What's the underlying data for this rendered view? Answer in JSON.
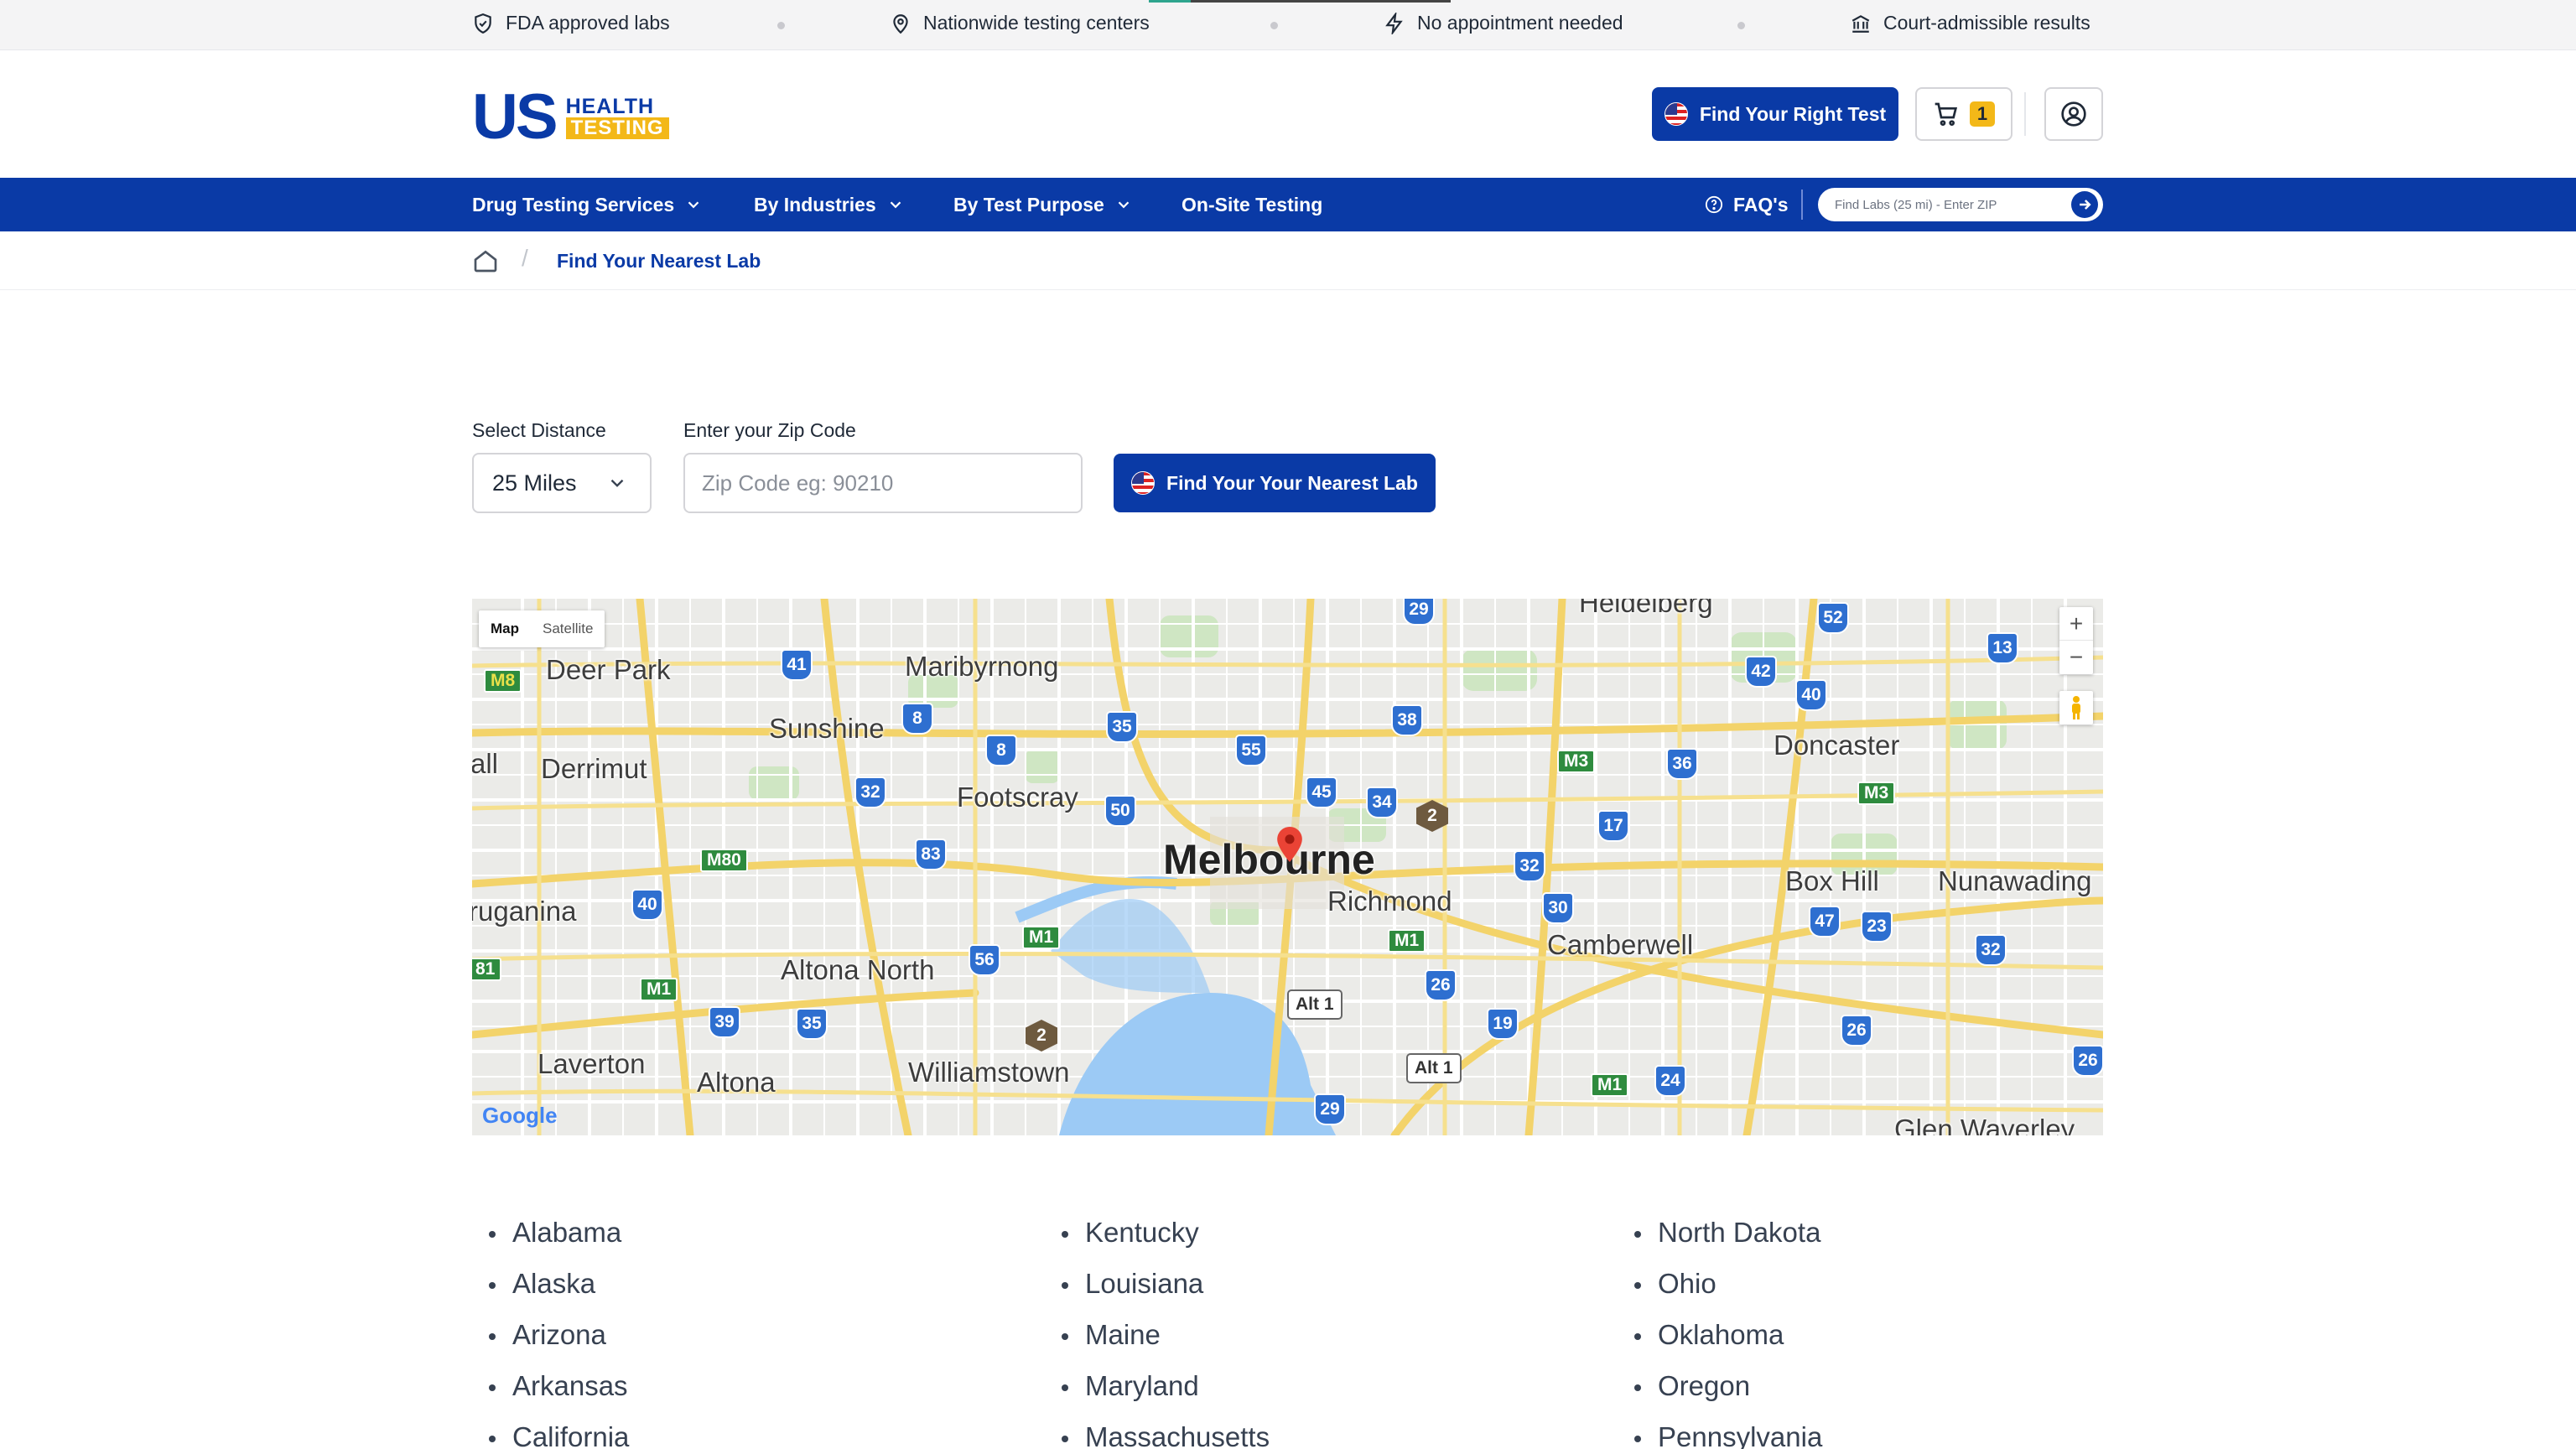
{
  "trust_bar": {
    "items": [
      {
        "label": "FDA approved labs",
        "icon": "shield-check-icon"
      },
      {
        "label": "Nationwide testing centers",
        "icon": "map-pin-icon"
      },
      {
        "label": "No appointment needed",
        "icon": "lightning-icon"
      },
      {
        "label": "Court-admissible results",
        "icon": "courthouse-icon"
      }
    ]
  },
  "brand": {
    "us": "US",
    "health": "HEALTH",
    "testing": "TESTING",
    "primary_color": "#0a3aa6",
    "accent_color": "#f3b818"
  },
  "header": {
    "find_test_label": "Find Your Right Test",
    "cart_count": "1"
  },
  "nav": {
    "items": [
      "Drug Testing Services",
      "By Industries",
      "By Test Purpose",
      "On-Site Testing"
    ],
    "faq_label": "FAQ's",
    "search_placeholder": "Find Labs (25 mi) - Enter ZIP"
  },
  "breadcrumb": {
    "current": "Find Your Nearest Lab"
  },
  "form": {
    "distance_label": "Select Distance",
    "distance_value": "25 Miles",
    "zip_label": "Enter your Zip Code",
    "zip_placeholder": "Zip Code eg: 90210",
    "submit_label": "Find Your Your Nearest Lab"
  },
  "map": {
    "toggle_map": "Map",
    "toggle_satellite": "Satellite",
    "zoom_in": "+",
    "zoom_out": "−",
    "attribution": "Google",
    "center_city": "Melbourne",
    "suburbs": [
      "Heidelberg",
      "Deer Park",
      "Maribyrnong",
      "Sunshine",
      "Derrimut",
      "Footscray",
      "Doncaster",
      "Richmond",
      "Box Hill",
      "Nunawading",
      "Camberwell",
      "Altona North",
      "Laverton",
      "Altona",
      "Williamstown",
      "Glen Waverley",
      "ruganina",
      "all"
    ],
    "routes": [
      "29",
      "52",
      "41",
      "42",
      "13",
      "40",
      "8",
      "35",
      "38",
      "55",
      "8",
      "36",
      "32",
      "45",
      "34",
      "50",
      "17",
      "83",
      "32",
      "30",
      "40",
      "47",
      "23",
      "32",
      "56",
      "26",
      "39",
      "35",
      "19",
      "26",
      "24",
      "26",
      "29"
    ],
    "m_routes": [
      "M8",
      "M3",
      "M3",
      "M80",
      "M1",
      "M1",
      "M1",
      "M1",
      "81"
    ],
    "alt_routes": [
      "Alt 1",
      "Alt 1"
    ],
    "tourist_routes": [
      "2",
      "2"
    ]
  },
  "states": {
    "col1": [
      "Alabama",
      "Alaska",
      "Arizona",
      "Arkansas",
      "California"
    ],
    "col2": [
      "Kentucky",
      "Louisiana",
      "Maine",
      "Maryland",
      "Massachusetts"
    ],
    "col3": [
      "North Dakota",
      "Ohio",
      "Oklahoma",
      "Oregon",
      "Pennsylvania"
    ]
  }
}
